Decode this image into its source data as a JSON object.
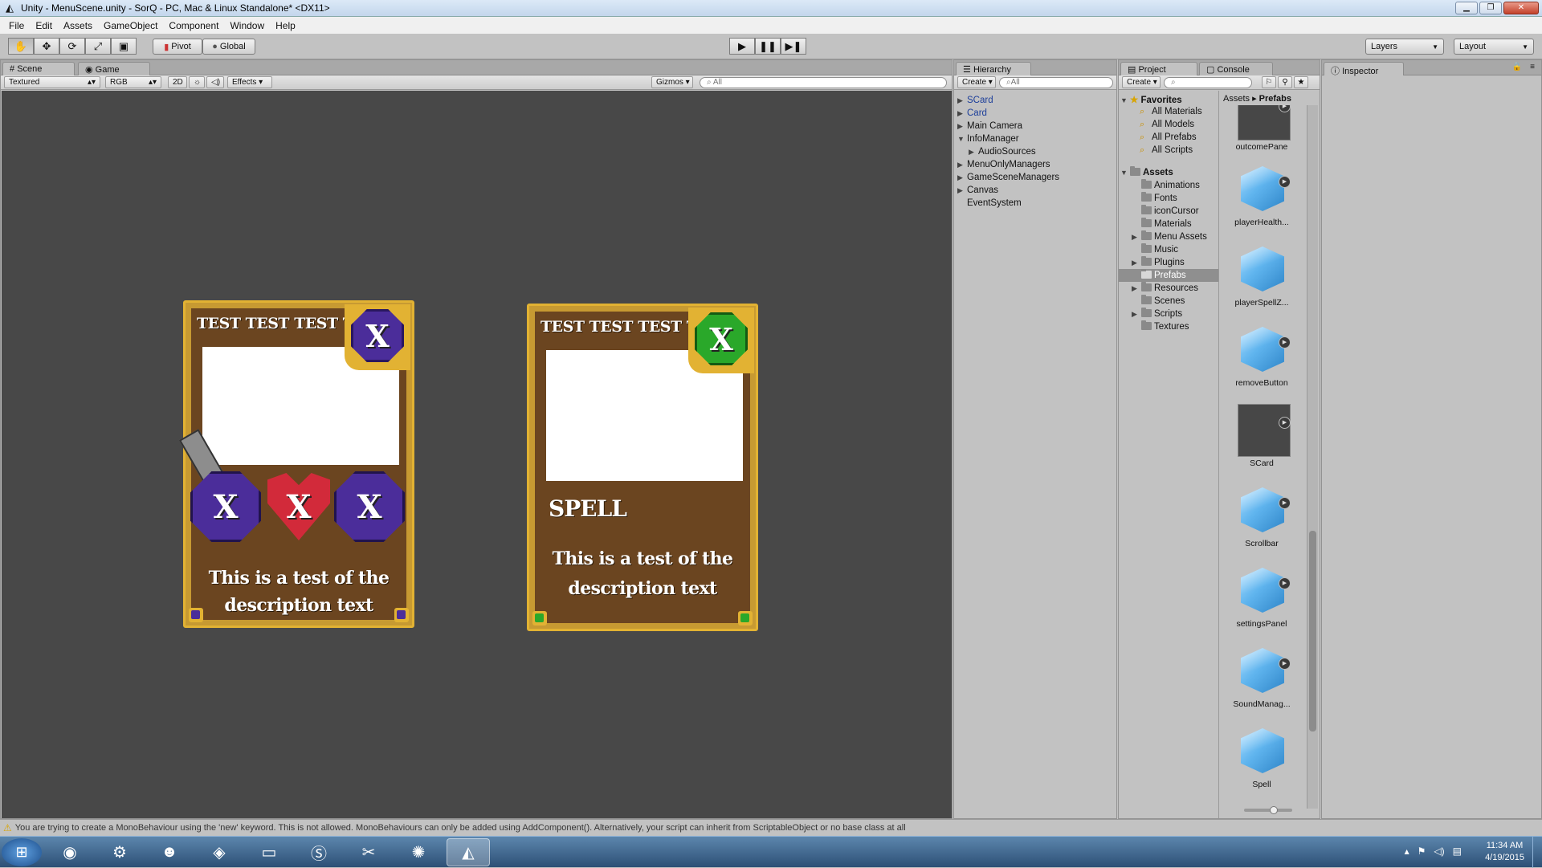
{
  "window": {
    "title": "Unity - MenuScene.unity - SorQ - PC, Mac & Linux Standalone* <DX11>"
  },
  "menu": [
    "File",
    "Edit",
    "Assets",
    "GameObject",
    "Component",
    "Window",
    "Help"
  ],
  "toolbar": {
    "pivot": "Pivot",
    "global": "Global",
    "layers": "Layers",
    "layout": "Layout"
  },
  "scene": {
    "tabs": {
      "scene": "Scene",
      "game": "Game"
    },
    "shading": "Textured",
    "color_mode": "RGB",
    "mode_2d": "2D",
    "effects": "Effects",
    "gizmos": "Gizmos",
    "search_placeholder": "All"
  },
  "cards": [
    {
      "title": "TEST TEST TEST TEST",
      "gem": "X",
      "stats": [
        "X",
        "X",
        "X"
      ],
      "description_line1": "This is a test of the",
      "description_line2": "description text",
      "accent": "#4b2d9a"
    },
    {
      "title": "TEST TEST TEST TEST",
      "gem": "X",
      "type_label": "SPELL",
      "description_line1": "This is a test of the",
      "description_line2": "description text",
      "accent": "#2aa82a"
    }
  ],
  "hierarchy": {
    "tab": "Hierarchy",
    "create": "Create",
    "search_placeholder": "All",
    "items": [
      "SCard",
      "Card",
      "Main Camera",
      "InfoManager",
      "AudioSources",
      "MenuOnlyManagers",
      "GameSceneManagers",
      "Canvas",
      "EventSystem"
    ]
  },
  "project": {
    "tab": "Project",
    "console_tab": "Console",
    "create": "Create",
    "favorites_label": "Favorites",
    "favorites": [
      "All Materials",
      "All Models",
      "All Prefabs",
      "All Scripts"
    ],
    "assets_label": "Assets",
    "folders": [
      "Animations",
      "Fonts",
      "iconCursor",
      "Materials",
      "Menu Assets",
      "Music",
      "Plugins",
      "Prefabs",
      "Resources",
      "Scenes",
      "Scripts",
      "Textures"
    ],
    "breadcrumb": {
      "root": "Assets",
      "current": "Prefabs"
    },
    "prefabs": [
      "outcomePane",
      "playerHealth...",
      "playerSpellZ...",
      "removeButton",
      "SCard",
      "Scrollbar",
      "settingsPanel",
      "SoundManag...",
      "Spell"
    ]
  },
  "inspector": {
    "tab": "Inspector"
  },
  "status": {
    "message": "You are trying to create a MonoBehaviour using the 'new' keyword.  This is not allowed.  MonoBehaviours can only be added using AddComponent().  Alternatively, your script can inherit from ScriptableObject or no base class at all"
  },
  "taskbar": {
    "time": "11:34 AM",
    "date": "4/19/2015"
  }
}
